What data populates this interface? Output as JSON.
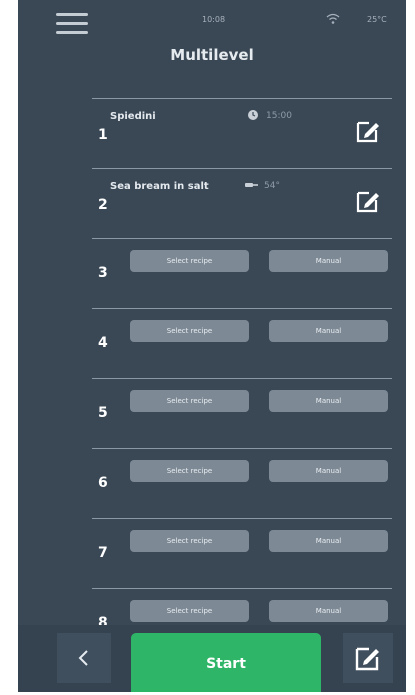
{
  "status": {
    "time": "10:08",
    "temperature": "25°C"
  },
  "title": "Multilevel",
  "levels": [
    {
      "number": "1",
      "recipe": "Spiedini",
      "info": "15:00",
      "info_icon": "timer-icon"
    },
    {
      "number": "2",
      "recipe": "Sea bream in salt",
      "info": "54°",
      "info_icon": "probe-icon"
    },
    {
      "number": "3",
      "select_label": "Select recipe",
      "manual_label": "Manual"
    },
    {
      "number": "4",
      "select_label": "Select recipe",
      "manual_label": "Manual"
    },
    {
      "number": "5",
      "select_label": "Select recipe",
      "manual_label": "Manual"
    },
    {
      "number": "6",
      "select_label": "Select recipe",
      "manual_label": "Manual"
    },
    {
      "number": "7",
      "select_label": "Select recipe",
      "manual_label": "Manual"
    },
    {
      "number": "8",
      "select_label": "Select recipe",
      "manual_label": "Manual"
    }
  ],
  "bottom": {
    "back_icon": "chevron-left-icon",
    "start_label": "Start",
    "edit_icon": "edit-icon"
  },
  "colors": {
    "background": "#3a4856",
    "start": "#2fb568",
    "pill": "#7d8995"
  }
}
